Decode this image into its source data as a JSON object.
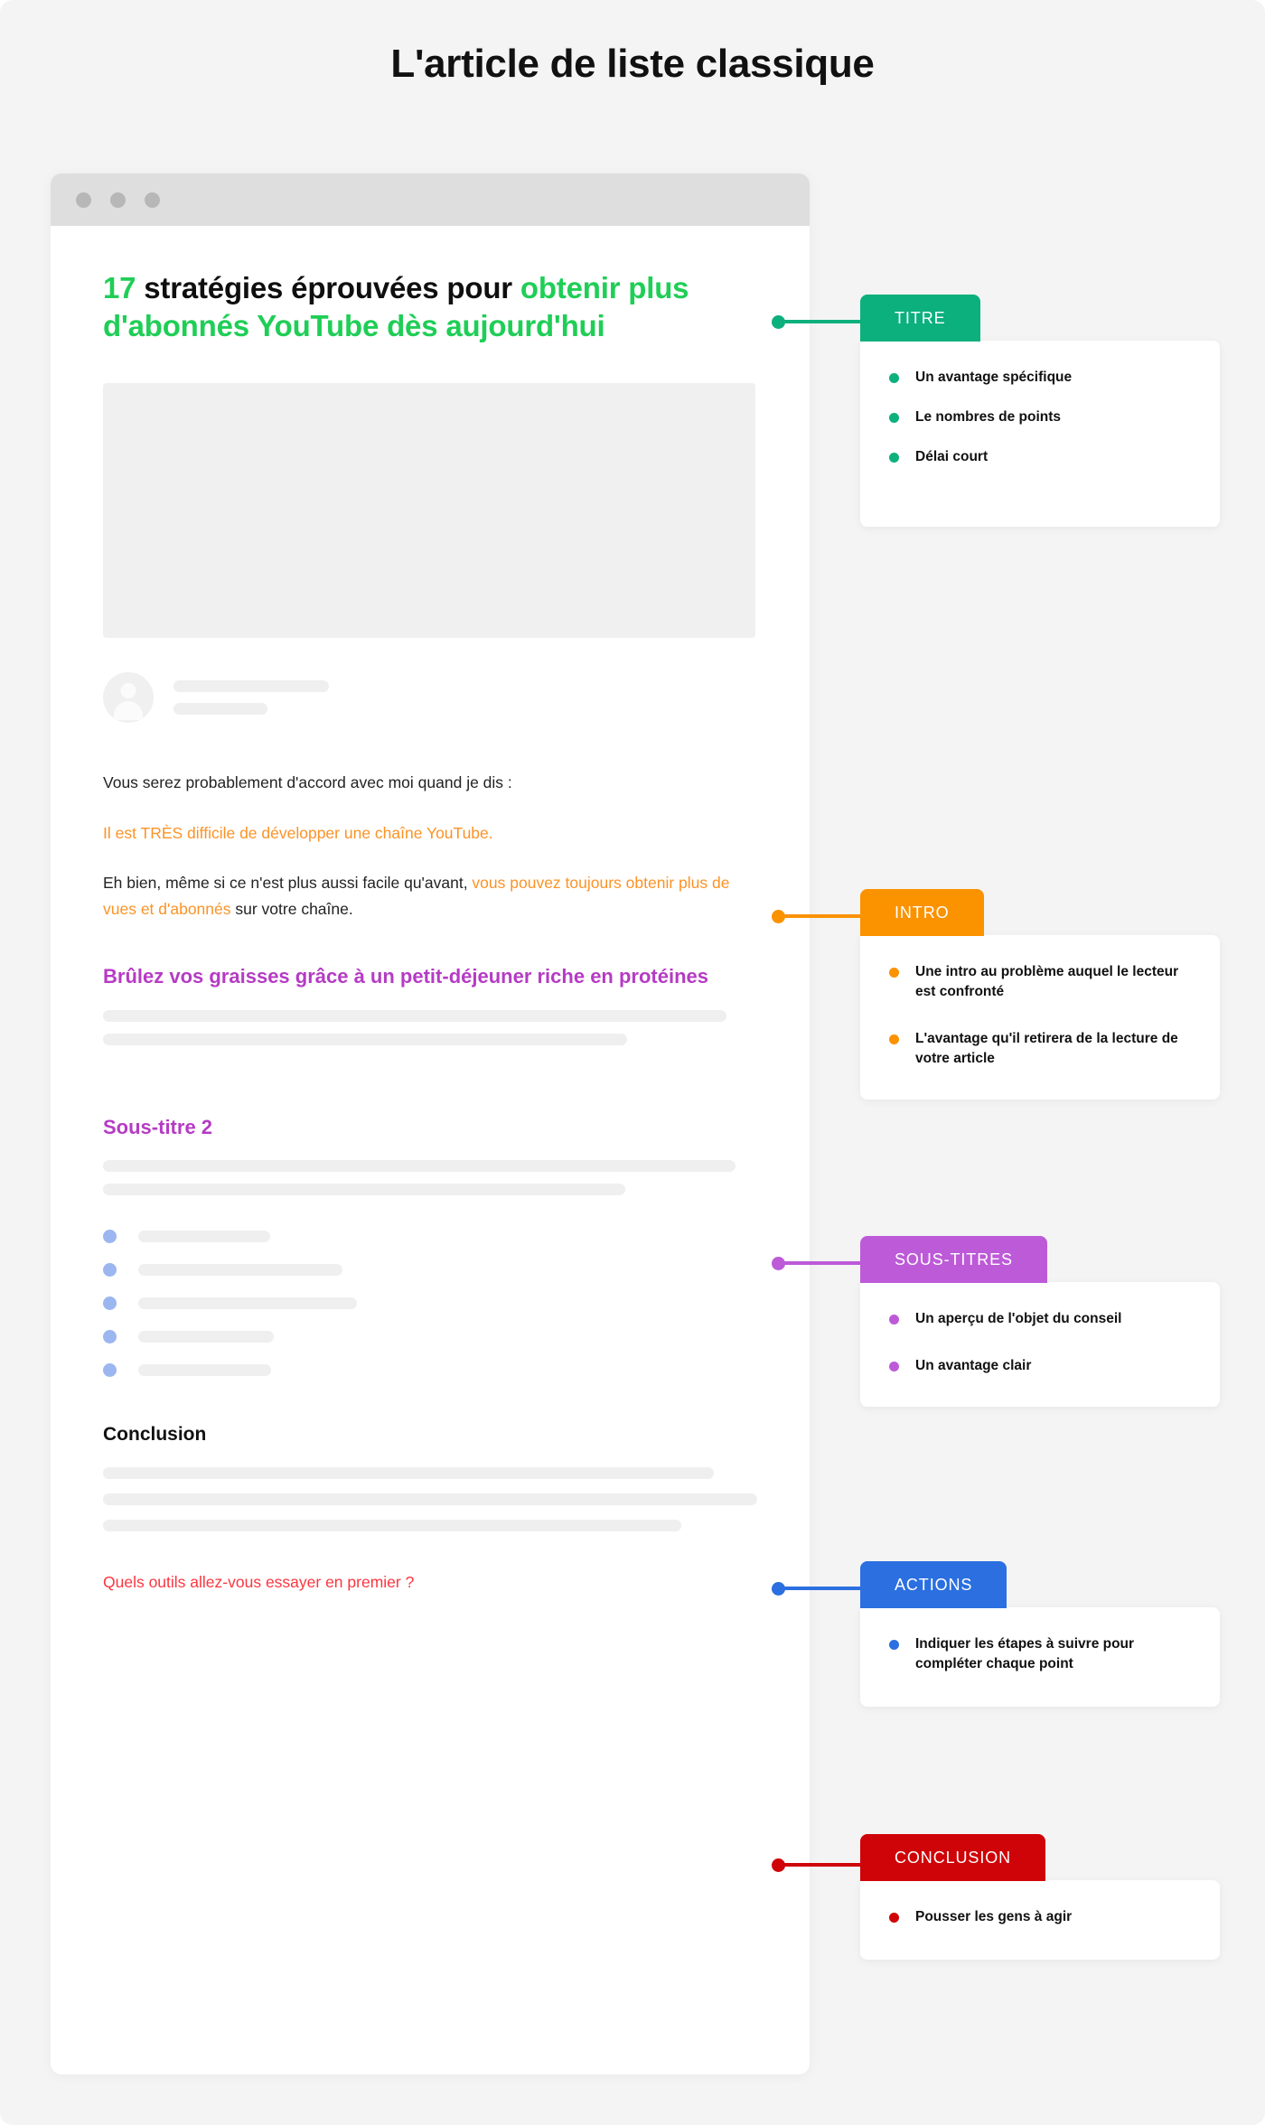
{
  "page": {
    "title": "L'article de liste classique",
    "background": "#f4f4f4"
  },
  "browser": {
    "dots": [
      "window-dot-red",
      "window-dot-yellow",
      "window-dot-green"
    ]
  },
  "article": {
    "headline": {
      "number": "17",
      "black_part": " stratégies éprouvées pour ",
      "green_part": "obtenir plus d'abonnés YouTube dès aujourd'hui"
    },
    "intro": {
      "para1": "Vous serez probablement d'accord avec moi quand je dis :",
      "para2": "Il est TRÈS difficile de développer une chaîne YouTube.",
      "para3_lead": "Eh bien, même si ce n'est plus aussi facile qu'avant, ",
      "para3_highlight": "vous pouvez toujours obtenir plus de vues et d'abonnés",
      "para3_tail": " sur votre chaîne."
    },
    "subheading_1": "Brûlez vos graisses grâce à un petit-déjeuner riche en protéines",
    "subheading_2": "Sous-titre 2",
    "conclusion_heading": "Conclusion",
    "closing_question": "Quels outils allez-vous essayer en premier ?"
  },
  "callouts": [
    {
      "id": "titre",
      "label": "TITRE",
      "color": "#0cb07c",
      "items": [
        "Un avantage spécifique",
        "Le nombres de points",
        "Délai court"
      ]
    },
    {
      "id": "intro",
      "label": "INTRO",
      "color": "#fb9200",
      "items": [
        "Une intro au problème auquel le lecteur est confronté",
        "L'avantage qu'il retirera de la lecture de votre article"
      ]
    },
    {
      "id": "sous-titres",
      "label": "SOUS-TITRES",
      "color": "#bd5ad8",
      "items": [
        "Un aperçu de l'objet du conseil",
        "Un avantage clair"
      ]
    },
    {
      "id": "actions",
      "label": "ACTIONS",
      "color": "#2b6fe0",
      "items": [
        "Indiquer les étapes à suivre pour compléter chaque point"
      ]
    },
    {
      "id": "conclusion",
      "label": "CONCLUSION",
      "color": "#cf0408",
      "items": [
        "Pousser les gens à agir"
      ]
    }
  ],
  "colors": {
    "headline_green": "#1fce56",
    "intro_orange": "#fb9327",
    "subheading_purple": "#b53bc4",
    "closing_red": "#fb3640",
    "bullet_blue": "#9cb6f0",
    "skeleton": "#efefef"
  }
}
